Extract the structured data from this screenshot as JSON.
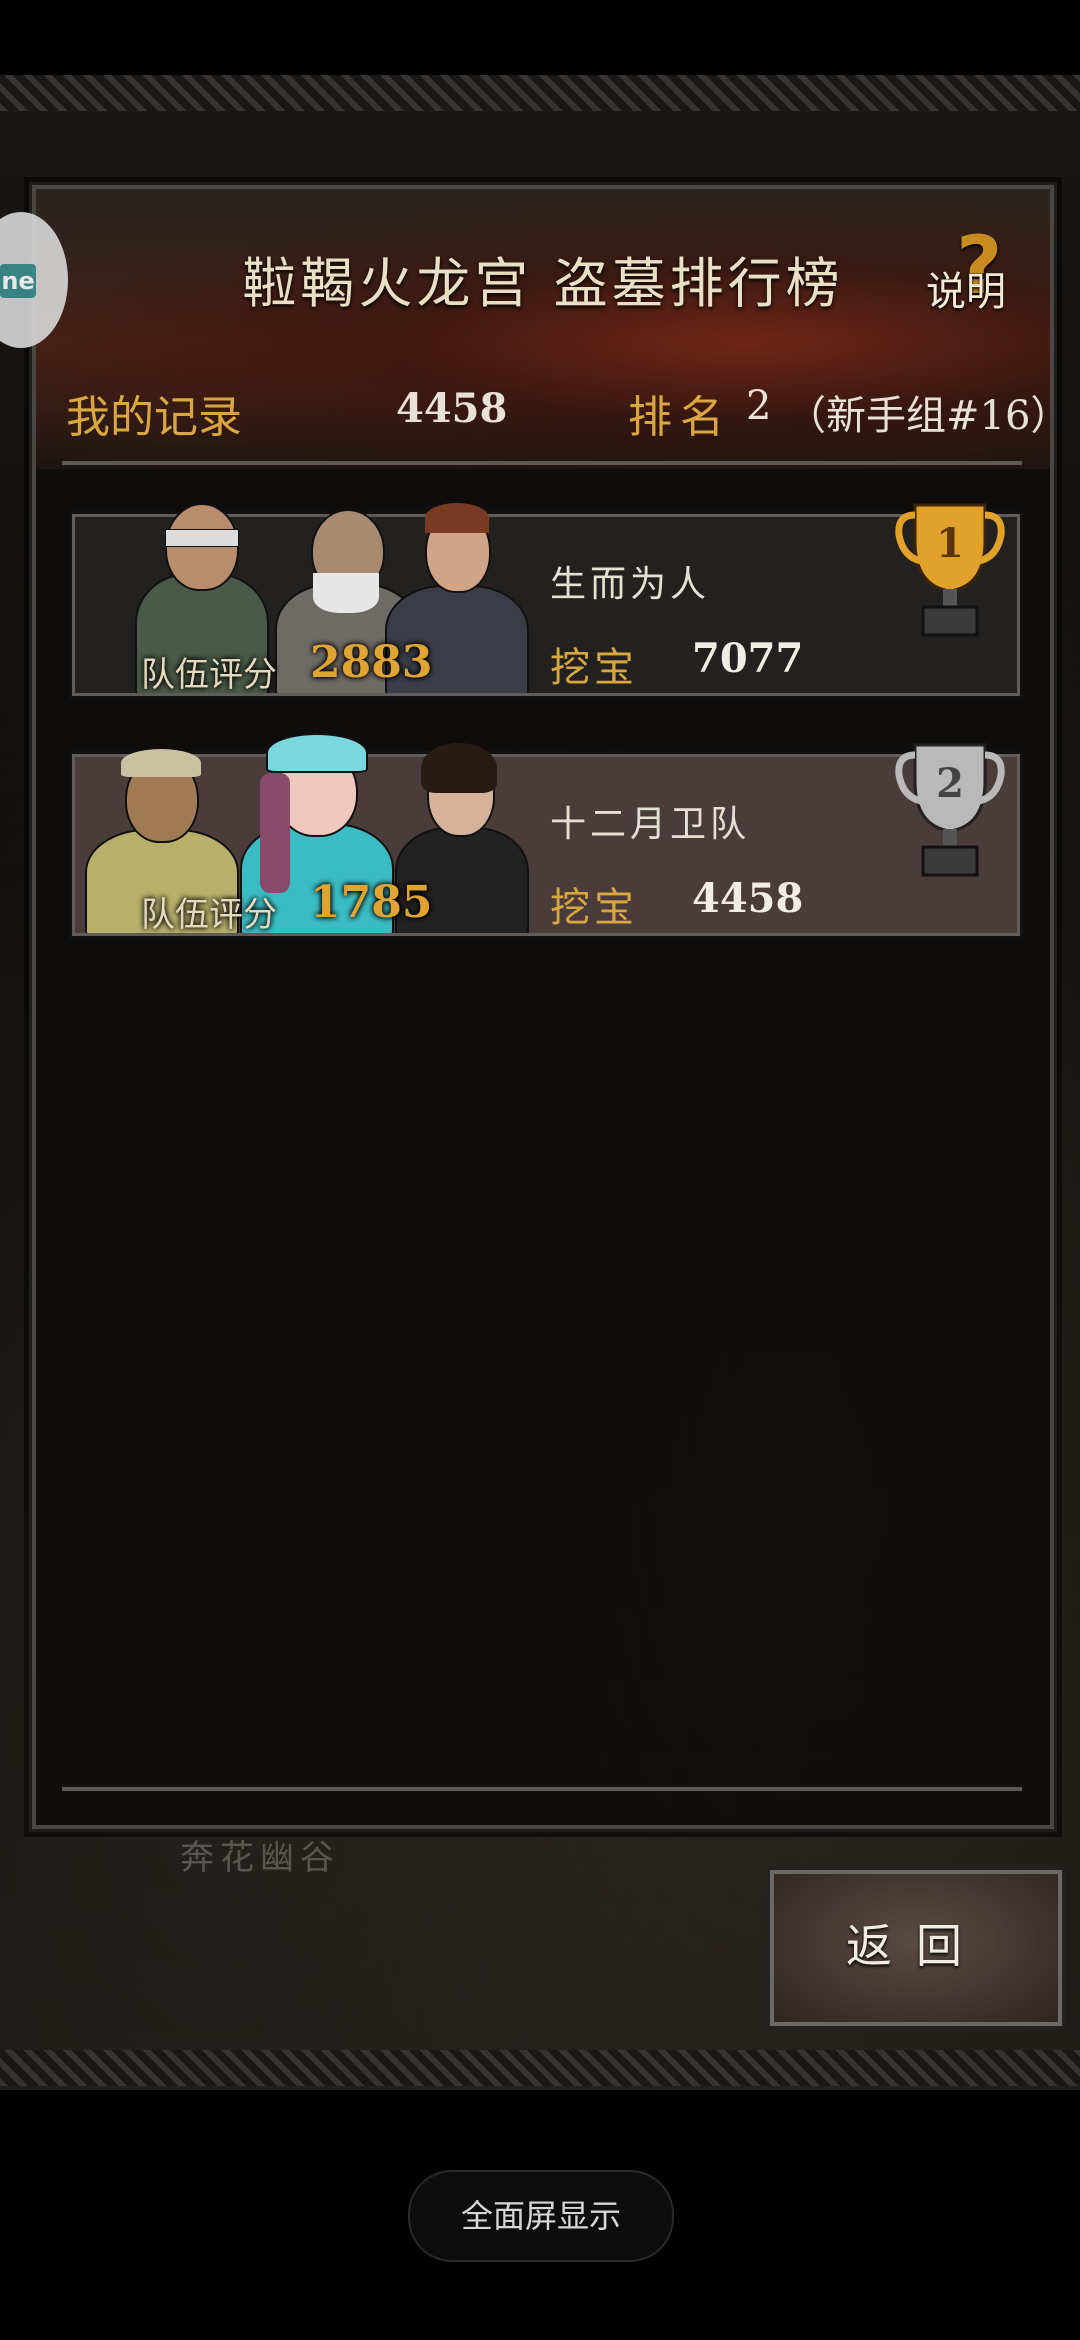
{
  "header": {
    "title": "鞡鞨火龙宫 盗墓排行榜",
    "help_label": "说明",
    "help_mark": "?"
  },
  "my_record": {
    "label": "我的记录",
    "score": "4458",
    "rank_label": "排名",
    "rank_value": "2",
    "rank_group": "（新手组#16）"
  },
  "rankings": [
    {
      "rank": "1",
      "team_score_label": "队伍评分",
      "team_score": "2883",
      "team_name": "生而为人",
      "treasure_label": "挖宝",
      "treasure_value": "7077",
      "trophy_color": "#e2a12a"
    },
    {
      "rank": "2",
      "team_score_label": "队伍评分",
      "team_score": "1785",
      "team_name": "十二月卫队",
      "treasure_label": "挖宝",
      "treasure_value": "4458",
      "trophy_color": "#b9b9b9"
    }
  ],
  "map": {
    "location_label": "奔花幽谷"
  },
  "back_button": {
    "label": "返回"
  },
  "side_widget": {
    "text": "ne"
  },
  "system": {
    "fullscreen_label": "全面屏显示"
  }
}
